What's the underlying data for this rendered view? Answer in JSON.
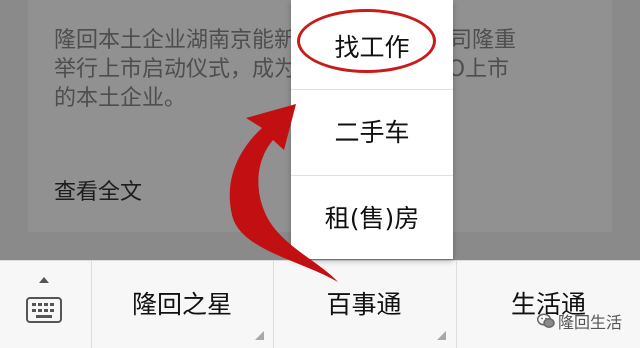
{
  "article": {
    "body": "隆回本土企业湖南京能新能源科技有限公司隆重\n举行上市启动仪式，成为首家正式启动IPO上市\n的本土企业。",
    "read_more": "查看全文"
  },
  "popup_menu": {
    "items": [
      {
        "label": "找工作"
      },
      {
        "label": "二手车"
      },
      {
        "label": "租(售)房"
      }
    ],
    "highlight_color": "#c81b1b"
  },
  "bottom_menu": {
    "keyboard_icon": "keyboard-icon",
    "items": [
      {
        "label": "隆回之星"
      },
      {
        "label": "百事通"
      },
      {
        "label": "生活通"
      }
    ]
  },
  "watermark": {
    "icon": "wechat-icon",
    "text": "隆回生活"
  }
}
